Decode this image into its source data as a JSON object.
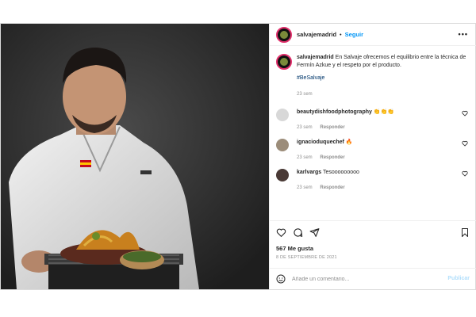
{
  "post": {
    "username": "salvajemadrid",
    "follow_label": "Seguir",
    "separator": "•",
    "more_label": "•••",
    "caption": {
      "username": "salvajemadrid",
      "text": "En Salvaje ofrecemos el equilibrio entre la técnica de Fermín Azkue y el respeto por el producto.",
      "hashtag": "#BeSalvaje",
      "time": "23 sem"
    },
    "comments": [
      {
        "username": "beautydishfoodphotography",
        "text": "👏👏👏",
        "time": "23 sem",
        "reply_label": "Responder",
        "avatar_color": "#d8d8d8"
      },
      {
        "username": "ignacioduquechef",
        "text": "🔥",
        "time": "23 sem",
        "reply_label": "Responder",
        "avatar_color": "#9c8d7a"
      },
      {
        "username": "karlvargs",
        "text": "Tesooooooooo",
        "time": "23 sem",
        "reply_label": "Responder",
        "avatar_color": "#4a3a36"
      }
    ],
    "likes": "567 Me gusta",
    "date": "8 DE SEPTIEMBRE DE 2021",
    "comment_placeholder": "Añade un comentario...",
    "publish_label": "Publicar"
  },
  "colors": {
    "accent": "#0095f6",
    "hashtag": "#00376b",
    "muted": "#8e8e8e",
    "publish_disabled": "#b2dffc"
  },
  "icons": [
    "more-icon",
    "heart-icon",
    "comment-icon",
    "share-icon",
    "bookmark-icon",
    "emoji-icon"
  ]
}
